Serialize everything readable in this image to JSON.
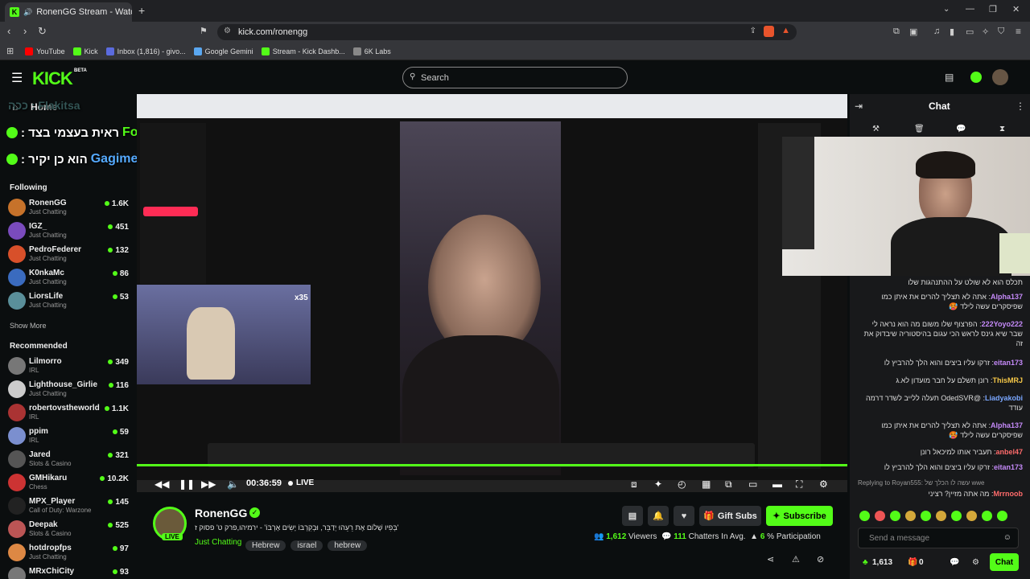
{
  "browser": {
    "tab_title": "RonenGG Stream - Watch Live",
    "new_tab": "+",
    "url": "kick.com/ronengg",
    "bookmarks": [
      "YouTube",
      "Kick",
      "Inbox (1,816) - givo...",
      "Google Gemini",
      "Stream - Kick Dashb...",
      "6K Labs"
    ]
  },
  "topnav": {
    "logo": "KICK",
    "beta": "BETA",
    "search_placeholder": "Search"
  },
  "sidebar": {
    "home": "Home",
    "following_header": "Following",
    "following": [
      {
        "name": "RonenGG",
        "cat": "Just Chatting",
        "count": "1.6K",
        "color": "#c6722a"
      },
      {
        "name": "IGZ_",
        "cat": "Just Chatting",
        "count": "451",
        "color": "#7a4bbd"
      },
      {
        "name": "PedroFederer",
        "cat": "Just Chatting",
        "count": "132",
        "color": "#d8502a"
      },
      {
        "name": "K0nkaMc",
        "cat": "Just Chatting",
        "count": "86",
        "color": "#3a6bbf"
      },
      {
        "name": "LiorsLife",
        "cat": "Just Chatting",
        "count": "53",
        "color": "#5a8f9a"
      }
    ],
    "show_more": "Show More",
    "recommended_header": "Recommended",
    "recommended": [
      {
        "name": "Lilmorro",
        "cat": "IRL",
        "count": "349",
        "color": "#777"
      },
      {
        "name": "Lighthouse_Girlie",
        "cat": "Just Chatting",
        "count": "116",
        "color": "#ccc"
      },
      {
        "name": "robertovstheworld",
        "cat": "IRL",
        "count": "1.1K",
        "color": "#a33"
      },
      {
        "name": "ppim",
        "cat": "IRL",
        "count": "59",
        "color": "#7b8fcf"
      },
      {
        "name": "Jared",
        "cat": "Slots & Casino",
        "count": "321",
        "color": "#555"
      },
      {
        "name": "GMHikaru",
        "cat": "Chess",
        "count": "10.2K",
        "color": "#c33"
      },
      {
        "name": "MPX_Player",
        "cat": "Call of Duty: Warzone",
        "count": "145",
        "color": "#222"
      },
      {
        "name": "Deepak",
        "cat": "Slots & Casino",
        "count": "525",
        "color": "#b55"
      },
      {
        "name": "hotdropfps",
        "cat": "Just Chatting",
        "count": "97",
        "color": "#d84"
      },
      {
        "name": "MRxChiCity",
        "cat": "",
        "count": "93",
        "color": "#777"
      }
    ]
  },
  "overlay": {
    "line1_user": "Forceee",
    "line1_text": "ראית בעצמי בצד :",
    "line2_user": "Gagimen",
    "line2_text": "הוא כן יקיר :",
    "line0_text": "Flakitsa : ככה",
    "gift_count": "x35"
  },
  "player": {
    "time": "00:36:59",
    "live": "LIVE"
  },
  "streamer": {
    "name": "RonenGG",
    "live_badge": "LIVE",
    "title": "'בְּפִיו שָׁלוֹם אֶת רֵעֵהוּ יְדַבֵּר, וּבְקִרְבּוֹ יָשִׂים אָרְבּוֹ' - ירמיהו,פרק ט' פסוק ז",
    "category": "Just Chatting",
    "tags": [
      "Hebrew",
      "israel",
      "hebrew"
    ],
    "viewers": "1,612",
    "viewers_label": "Viewers",
    "chatters": "111",
    "chatters_label": "Chatters In Avg.",
    "participation": "6",
    "participation_label": "% Participation",
    "gift_subs": "Gift Subs",
    "subscribe": "Subscribe"
  },
  "chat": {
    "title": "Chat",
    "messages": [
      {
        "user": "",
        "color": "#ddd",
        "text": "תכלס הוא לא שולט על ההתנהגות שלו"
      },
      {
        "user": "Alpha137",
        "color": "#c58af9",
        "text": "אתה לא תצליך להרים את איתן כמו שפיסקרים עשה לילד 🥵"
      },
      {
        "user": "222Yoyo222",
        "color": "#c58af9",
        "text": "הפרצוף שלו משום מה הוא נראה לי שבר שיא גינס לראש הכי עגום בהיסטוריה שיבדוק את זה"
      },
      {
        "user": "eitan173",
        "color": "#c58af9",
        "text": "זרקו עליו ביצים והוא הלך להרביץ לו"
      },
      {
        "user": "ThisMRJ",
        "color": "#f7c948",
        "text": "רונן תשלם על חבר מועדון לא.ג"
      },
      {
        "user": "Liadyakobi",
        "color": "#7aa7ff",
        "text": "@OdedSVR תעלה ללייב לשדר דרמה עודד"
      },
      {
        "user": "Alpha137",
        "color": "#c58af9",
        "text": "אתה לא תצליך להרים את איתן כמו שפיסקרים עשה לילד 🥵"
      },
      {
        "user": "anbel47",
        "color": "#ff6b6b",
        "text": "תעביר אותו למיכאל רונן"
      },
      {
        "user": "eitan173",
        "color": "#c58af9",
        "text": "זרקו עליו ביצים והוא הלך להרביץ לו"
      }
    ],
    "reply_to": "Replying to Royan555: עשה לו הכלך של wwe",
    "last_user": "Mrrnoob",
    "last_text": "מה אתה מזיין? רציני",
    "input_placeholder": "Send a message",
    "points": "1,613",
    "zero": "0",
    "chat_button": "Chat"
  },
  "colors": {
    "brand": "#53fc18",
    "background": "#0b0e0f",
    "chat_bg": "#18191b"
  }
}
